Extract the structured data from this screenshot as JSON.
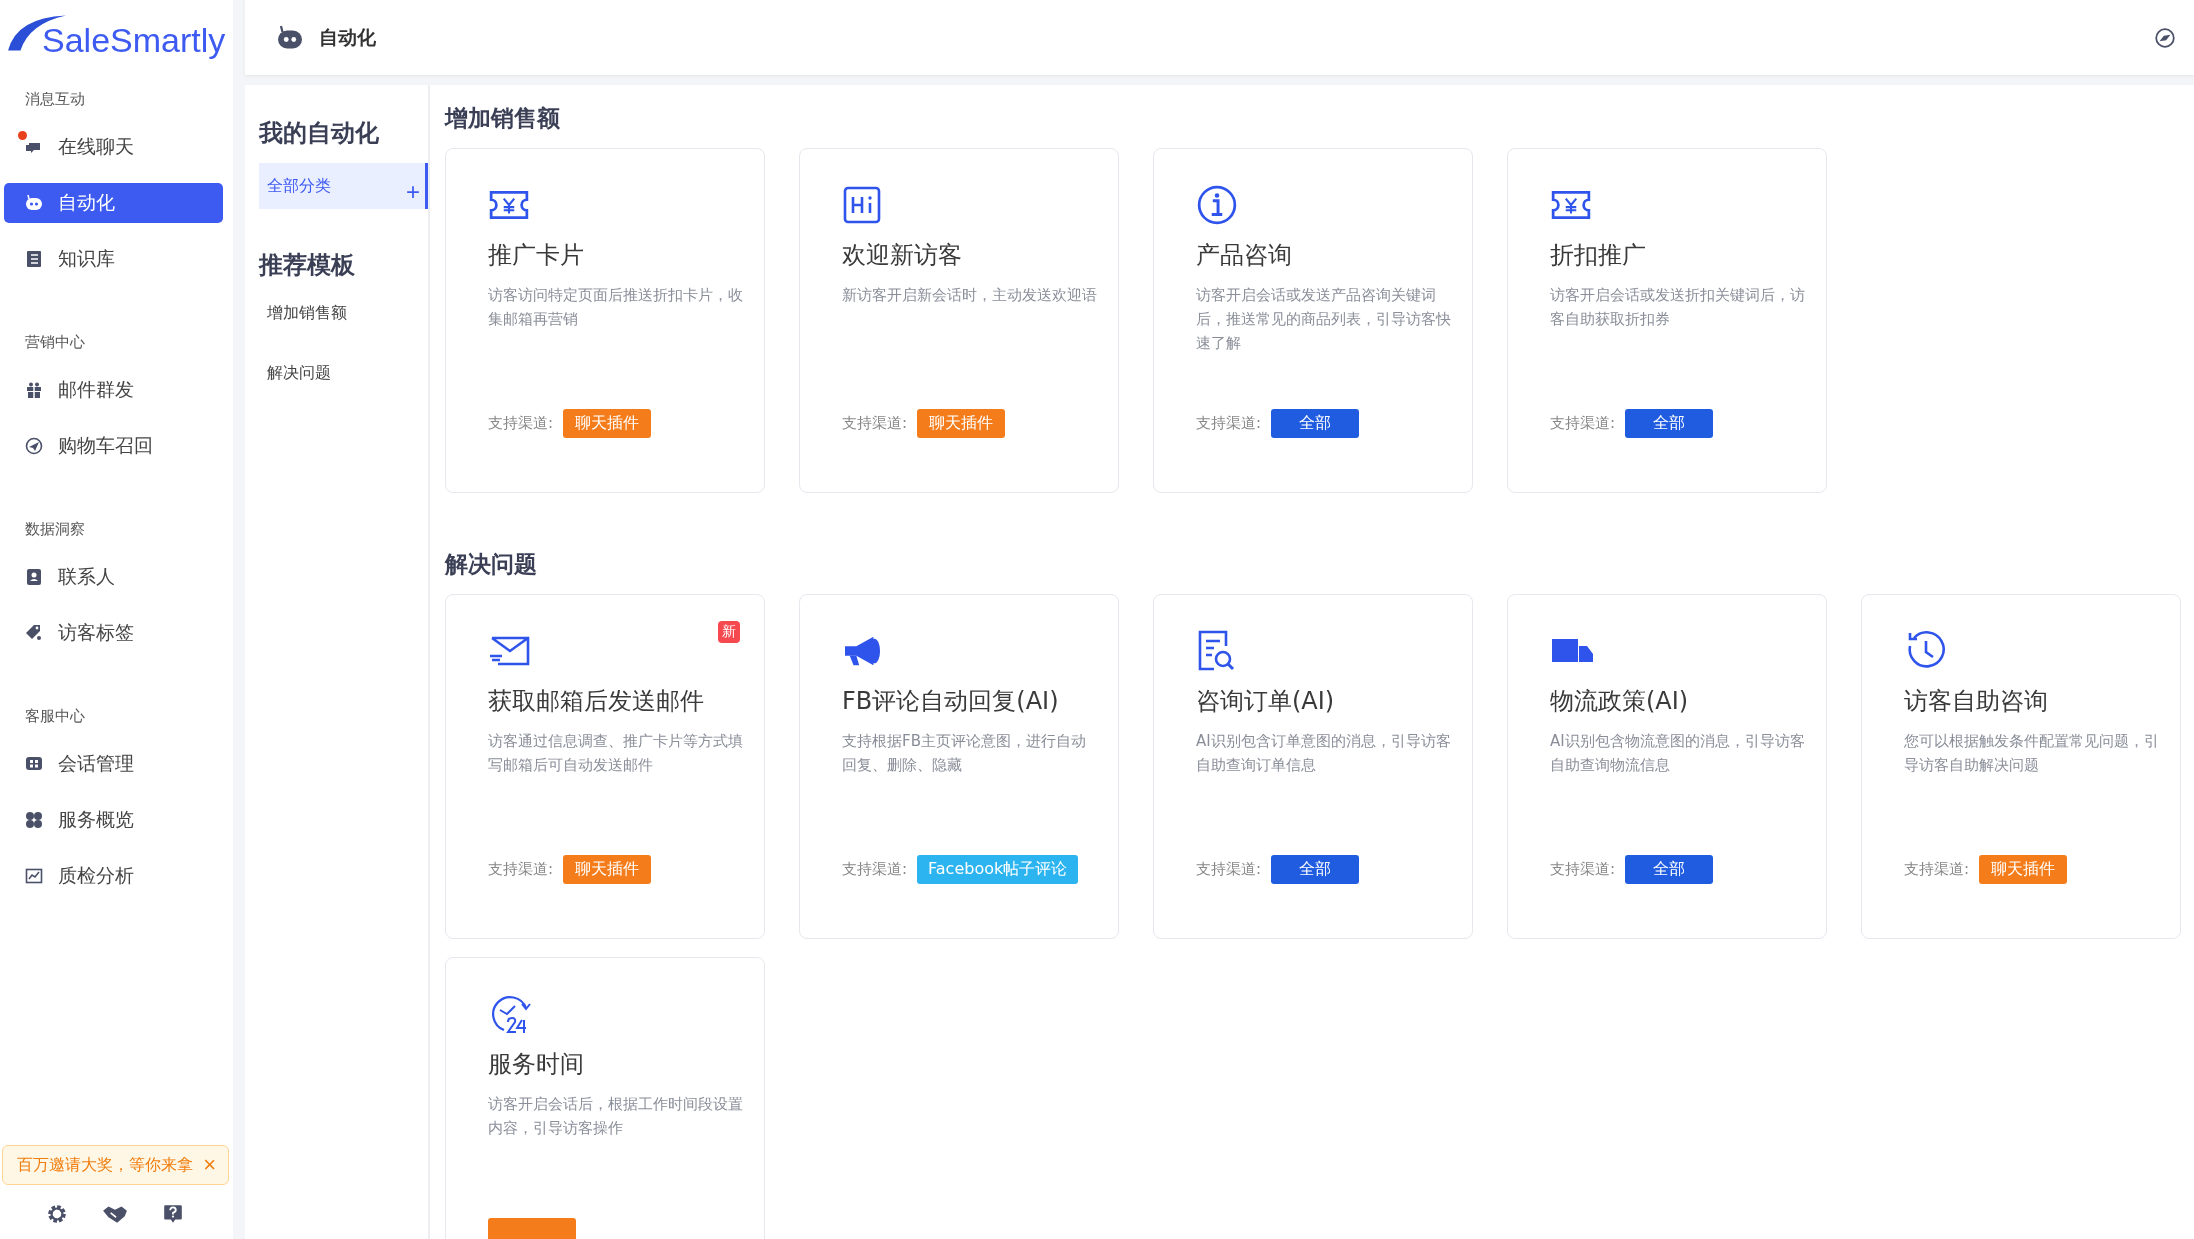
{
  "logo": "SaleSmartly",
  "sidebar": {
    "groups": [
      {
        "label": "消息互动",
        "items": [
          {
            "label": "在线聊天",
            "selected": false,
            "dot": true
          },
          {
            "label": "自动化",
            "selected": true,
            "dot": false
          },
          {
            "label": "知识库",
            "selected": false,
            "dot": false
          }
        ]
      },
      {
        "label": "营销中心",
        "items": [
          {
            "label": "邮件群发",
            "selected": false,
            "dot": false
          },
          {
            "label": "购物车召回",
            "selected": false,
            "dot": false
          }
        ]
      },
      {
        "label": "数据洞察",
        "items": [
          {
            "label": "联系人",
            "selected": false,
            "dot": false
          },
          {
            "label": "访客标签",
            "selected": false,
            "dot": false
          }
        ]
      },
      {
        "label": "客服中心",
        "items": [
          {
            "label": "会话管理",
            "selected": false,
            "dot": false
          },
          {
            "label": "服务概览",
            "selected": false,
            "dot": false
          },
          {
            "label": "质检分析",
            "selected": false,
            "dot": false
          }
        ]
      }
    ],
    "promo": {
      "text": "百万邀请大奖，等你来拿",
      "close": "×"
    }
  },
  "header": {
    "title": "自动化"
  },
  "subnav": {
    "my_title": "我的自动化",
    "categories": [
      {
        "label": "全部分类",
        "selected": true
      }
    ],
    "add": "+",
    "template_title": "推荐模板",
    "templates": [
      {
        "label": "增加销售额",
        "selected": false
      },
      {
        "label": "解决问题",
        "selected": false
      }
    ]
  },
  "sections": [
    {
      "title": "增加销售额",
      "cards": [
        {
          "title": "推广卡片",
          "desc": "访客访问特定页面后推送折扣卡片，收集邮箱再营销",
          "channel_label": "支持渠道:",
          "channel": {
            "kind": "plugin",
            "label": "聊天插件"
          }
        },
        {
          "title": "欢迎新访客",
          "desc": "新访客开启新会话时，主动发送欢迎语",
          "channel_label": "支持渠道:",
          "channel": {
            "kind": "plugin",
            "label": "聊天插件"
          }
        },
        {
          "title": "产品咨询",
          "desc": "访客开启会话或发送产品咨询关键词后，推送常见的商品列表，引导访客快速了解",
          "channel_label": "支持渠道:",
          "channel": {
            "kind": "all",
            "label": "全部"
          }
        },
        {
          "title": "折扣推广",
          "desc": "访客开启会话或发送折扣关键词后，访客自助获取折扣券",
          "channel_label": "支持渠道:",
          "channel": {
            "kind": "all",
            "label": "全部"
          }
        }
      ]
    },
    {
      "title": "解决问题",
      "cards": [
        {
          "title": "获取邮箱后发送邮件",
          "badge": "新",
          "desc": "访客通过信息调查、推广卡片等方式填写邮箱后可自动发送邮件",
          "channel_label": "支持渠道:",
          "channel": {
            "kind": "plugin",
            "label": "聊天插件"
          }
        },
        {
          "title": "FB评论自动回复(AI)",
          "desc": "支持根据FB主页评论意图，进行自动回复、删除、隐藏",
          "channel_label": "支持渠道:",
          "channel": {
            "kind": "facebook",
            "label": "Facebook帖子评论"
          }
        },
        {
          "title": "咨询订单(AI)",
          "desc": "AI识别包含订单意图的消息，引导访客自助查询订单信息",
          "channel_label": "支持渠道:",
          "channel": {
            "kind": "all",
            "label": "全部"
          }
        },
        {
          "title": "物流政策(AI)",
          "desc": "AI识别包含物流意图的消息，引导访客自助查询物流信息",
          "channel_label": "支持渠道:",
          "channel": {
            "kind": "all",
            "label": "全部"
          }
        },
        {
          "title": "访客自助咨询",
          "desc": "您可以根据触发条件配置常见问题，引导访客自助解决问题",
          "channel_label": "支持渠道:",
          "channel": {
            "kind": "plugin",
            "label": "聊天插件"
          }
        },
        {
          "title": "服务时间",
          "desc": "访客开启会话后，根据工作时间段设置内容，引导访客操作",
          "channel": {
            "kind": "plugin"
          }
        }
      ]
    }
  ]
}
